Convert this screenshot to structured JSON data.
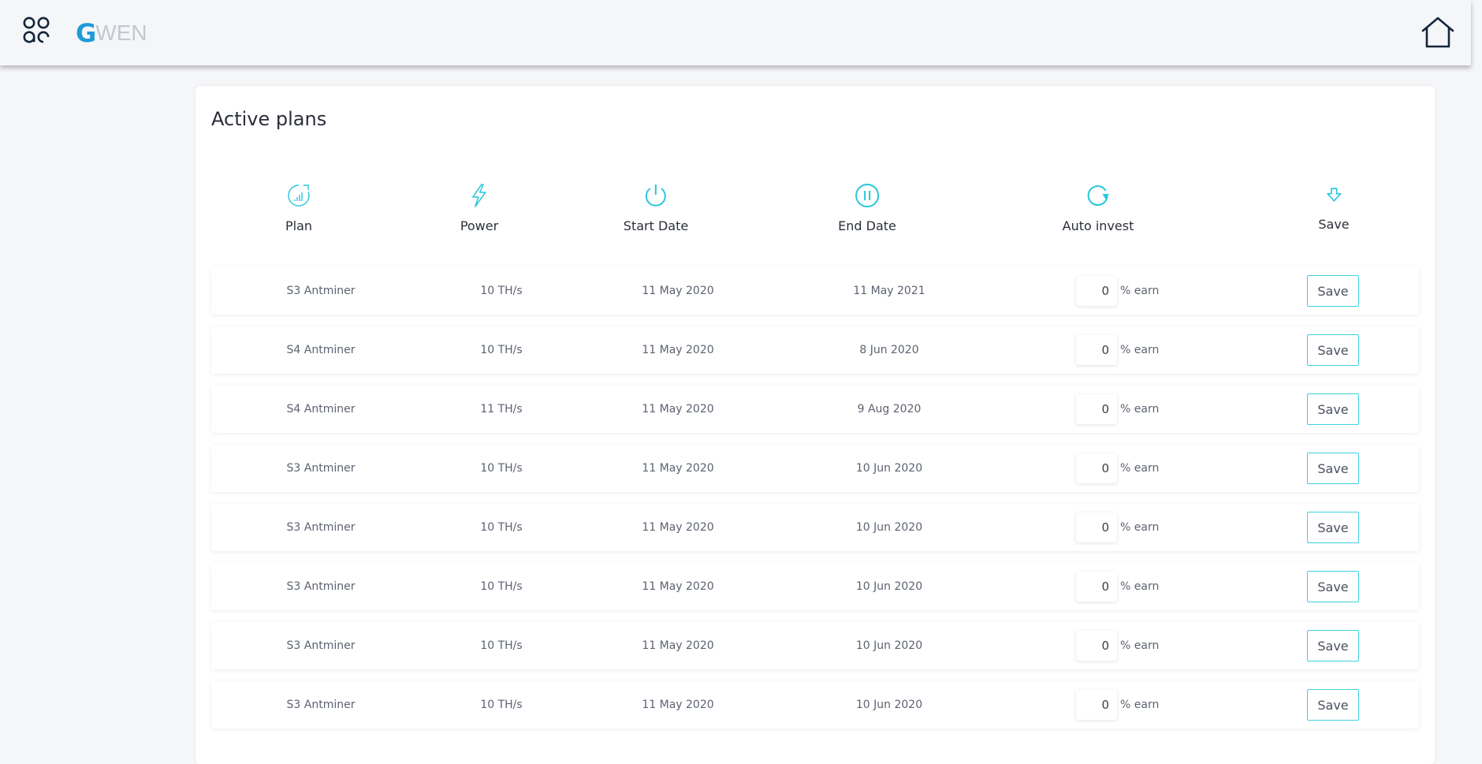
{
  "header": {
    "logo_letter": "G",
    "logo_text": "WEN",
    "colors": {
      "brand": "#1e9bd7",
      "accent": "#25c7dc",
      "dark_icon": "#14253b"
    }
  },
  "card": {
    "title": "Active plans",
    "columns": [
      {
        "label": "Plan",
        "icon": "plan-chart-icon"
      },
      {
        "label": "Power",
        "icon": "lightning-bolt-icon"
      },
      {
        "label": "Start Date",
        "icon": "power-icon"
      },
      {
        "label": "End Date",
        "icon": "pause-circle-icon"
      },
      {
        "label": "Auto invest",
        "icon": "refresh-icon"
      },
      {
        "label": "Save",
        "icon": "arrow-down-icon"
      }
    ],
    "earn_suffix": "% earn",
    "save_label": "Save",
    "rows": [
      {
        "plan": "S3 Antminer",
        "power": "10 TH/s",
        "start": "11 May 2020",
        "end": "11 May 2021",
        "auto": "0"
      },
      {
        "plan": "S4 Antminer",
        "power": "10 TH/s",
        "start": "11 May 2020",
        "end": "8 Jun 2020",
        "auto": "0"
      },
      {
        "plan": "S4 Antminer",
        "power": "11 TH/s",
        "start": "11 May 2020",
        "end": "9 Aug 2020",
        "auto": "0"
      },
      {
        "plan": "S3 Antminer",
        "power": "10 TH/s",
        "start": "11 May 2020",
        "end": "10 Jun 2020",
        "auto": "0"
      },
      {
        "plan": "S3 Antminer",
        "power": "10 TH/s",
        "start": "11 May 2020",
        "end": "10 Jun 2020",
        "auto": "0"
      },
      {
        "plan": "S3 Antminer",
        "power": "10 TH/s",
        "start": "11 May 2020",
        "end": "10 Jun 2020",
        "auto": "0"
      },
      {
        "plan": "S3 Antminer",
        "power": "10 TH/s",
        "start": "11 May 2020",
        "end": "10 Jun 2020",
        "auto": "0"
      },
      {
        "plan": "S3 Antminer",
        "power": "10 TH/s",
        "start": "11 May 2020",
        "end": "10 Jun 2020",
        "auto": "0"
      }
    ]
  }
}
